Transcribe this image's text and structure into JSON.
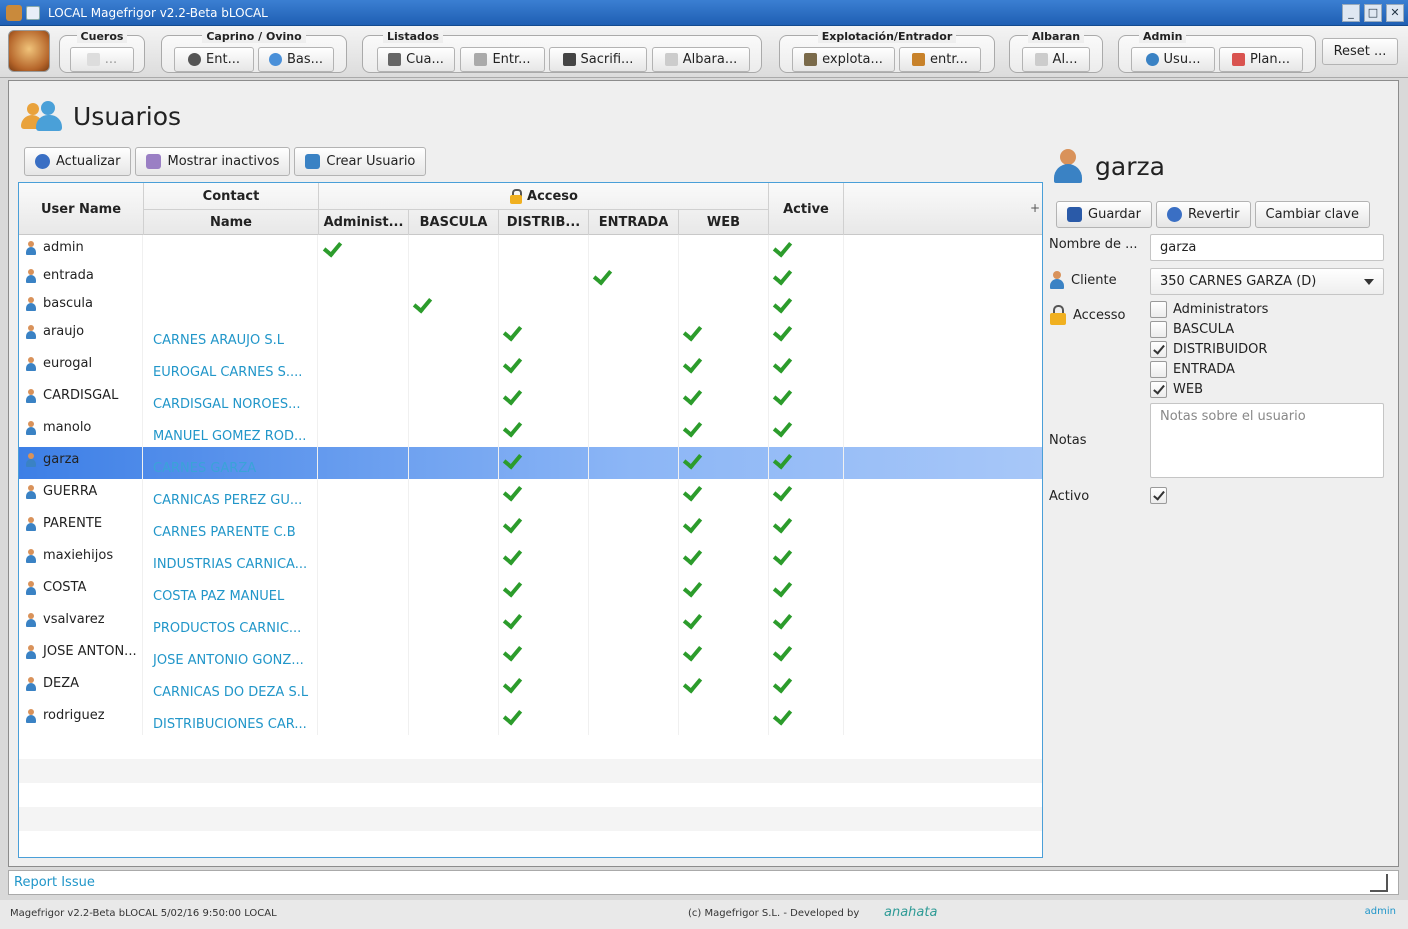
{
  "window": {
    "title": "LOCAL Magefrigor v2.2-Beta bLOCAL"
  },
  "ribbon": {
    "groups": [
      {
        "label": "Cueros",
        "buttons": [
          "..."
        ]
      },
      {
        "label": "Caprino / Ovino",
        "buttons": [
          "Ent...",
          "Bas..."
        ]
      },
      {
        "label": "Listados",
        "buttons": [
          "Cua...",
          "Entr...",
          "Sacrifi...",
          "Albara..."
        ]
      },
      {
        "label": "Explotación/Entrador",
        "buttons": [
          "explota...",
          "entr..."
        ]
      },
      {
        "label": "Albaran",
        "buttons": [
          "Al..."
        ]
      },
      {
        "label": "Admin",
        "buttons": [
          "Usu...",
          "Plan..."
        ]
      }
    ],
    "reset_label": "Reset ..."
  },
  "page": {
    "title": "Usuarios"
  },
  "toolbar": {
    "refresh": "Actualizar",
    "show_inactive": "Mostrar inactivos",
    "create_user": "Crear Usuario"
  },
  "table": {
    "headers": {
      "user_name": "User Name",
      "contact": "Contact",
      "name": "Name",
      "access": "Acceso",
      "admin": "Administ...",
      "bascula": "BASCULA",
      "distrib": "DISTRIB...",
      "entrada": "ENTRADA",
      "web": "WEB",
      "active": "Active",
      "plus": "+"
    },
    "rows": [
      {
        "user": "admin",
        "contact": "",
        "admin": true,
        "bascula": false,
        "distrib": false,
        "entrada": false,
        "web": false,
        "active": true
      },
      {
        "user": "entrada",
        "contact": "",
        "admin": false,
        "bascula": false,
        "distrib": false,
        "entrada": true,
        "web": false,
        "active": true
      },
      {
        "user": "bascula",
        "contact": "",
        "admin": false,
        "bascula": true,
        "distrib": false,
        "entrada": false,
        "web": false,
        "active": true
      },
      {
        "user": "araujo",
        "contact": "CARNES ARAUJO S.L",
        "admin": false,
        "bascula": false,
        "distrib": true,
        "entrada": false,
        "web": true,
        "active": true
      },
      {
        "user": "eurogal",
        "contact": "EUROGAL CARNES S....",
        "admin": false,
        "bascula": false,
        "distrib": true,
        "entrada": false,
        "web": true,
        "active": true
      },
      {
        "user": "CARDISGAL",
        "contact": "CARDISGAL NOROES...",
        "admin": false,
        "bascula": false,
        "distrib": true,
        "entrada": false,
        "web": true,
        "active": true
      },
      {
        "user": "manolo",
        "contact": "MANUEL GOMEZ ROD...",
        "admin": false,
        "bascula": false,
        "distrib": true,
        "entrada": false,
        "web": true,
        "active": true
      },
      {
        "user": "garza",
        "contact": "CARNES GARZA",
        "admin": false,
        "bascula": false,
        "distrib": true,
        "entrada": false,
        "web": true,
        "active": true,
        "selected": true
      },
      {
        "user": "GUERRA",
        "contact": "CARNICAS PEREZ GU...",
        "admin": false,
        "bascula": false,
        "distrib": true,
        "entrada": false,
        "web": true,
        "active": true
      },
      {
        "user": "PARENTE",
        "contact": "CARNES PARENTE C.B",
        "admin": false,
        "bascula": false,
        "distrib": true,
        "entrada": false,
        "web": true,
        "active": true
      },
      {
        "user": "maxiehijos",
        "contact": "INDUSTRIAS CARNICA...",
        "admin": false,
        "bascula": false,
        "distrib": true,
        "entrada": false,
        "web": true,
        "active": true
      },
      {
        "user": "COSTA",
        "contact": "COSTA PAZ MANUEL",
        "admin": false,
        "bascula": false,
        "distrib": true,
        "entrada": false,
        "web": true,
        "active": true
      },
      {
        "user": "vsalvarez",
        "contact": "PRODUCTOS CARNIC...",
        "admin": false,
        "bascula": false,
        "distrib": true,
        "entrada": false,
        "web": true,
        "active": true
      },
      {
        "user": "JOSE ANTON...",
        "contact": "JOSE ANTONIO GONZ...",
        "admin": false,
        "bascula": false,
        "distrib": true,
        "entrada": false,
        "web": true,
        "active": true
      },
      {
        "user": "DEZA",
        "contact": "CARNICAS DO DEZA S.L",
        "admin": false,
        "bascula": false,
        "distrib": true,
        "entrada": false,
        "web": true,
        "active": true
      },
      {
        "user": "rodriguez",
        "contact": "DISTRIBUCIONES CAR...",
        "admin": false,
        "bascula": false,
        "distrib": true,
        "entrada": false,
        "web": false,
        "active": true
      }
    ]
  },
  "detail": {
    "user_name": "garza",
    "buttons": {
      "save": "Guardar",
      "revert": "Revertir",
      "change_password": "Cambiar clave"
    },
    "labels": {
      "name": "Nombre de ...",
      "client": "Cliente",
      "access": "Accesso",
      "notes": "Notas",
      "active": "Activo"
    },
    "name_value": "garza",
    "client_value": "350 CARNES GARZA (D)",
    "access_options": [
      {
        "label": "Administrators",
        "checked": false
      },
      {
        "label": "BASCULA",
        "checked": false
      },
      {
        "label": "DISTRIBUIDOR",
        "checked": true
      },
      {
        "label": "ENTRADA",
        "checked": false
      },
      {
        "label": "WEB",
        "checked": true
      }
    ],
    "notes_placeholder": "Notas sobre el usuario",
    "active": true
  },
  "footer": {
    "report_issue": "Report Issue",
    "status_left": "Magefrigor v2.2-Beta bLOCAL 5/02/16 9:50:00 LOCAL",
    "status_center": "(c)  Magefrigor S.L.   - Developed by",
    "developer": "anahata",
    "status_user": "admin"
  },
  "colors": {
    "accent": "#2196c9",
    "selection": "#3d7fe6",
    "check": "#2c9c2c"
  }
}
